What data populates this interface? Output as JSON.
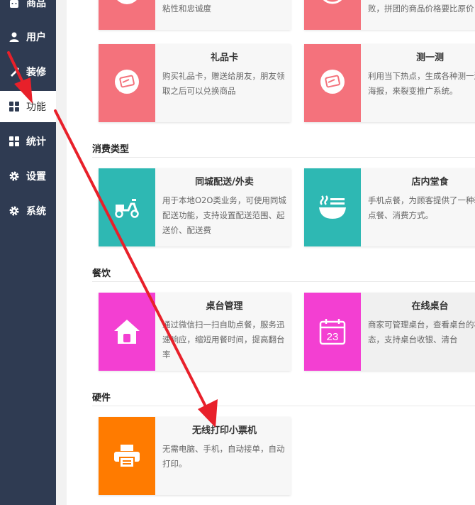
{
  "sidebar": {
    "items": [
      {
        "label": "商品",
        "icon": "bag-icon"
      },
      {
        "label": "用户",
        "icon": "user-icon"
      },
      {
        "label": "装修",
        "icon": "brush-icon"
      },
      {
        "label": "功能",
        "icon": "grid-icon",
        "active": true
      },
      {
        "label": "统计",
        "icon": "grid-icon"
      },
      {
        "label": "设置",
        "icon": "gear-icon"
      },
      {
        "label": "系统",
        "icon": "gear-icon"
      }
    ]
  },
  "top_cards": [
    {
      "desc": "值开消费赤额，生复购，提高客户粘性和忠诚度"
    },
    {
      "desc": "一起购买才能完成拼团，否则失败，拼团的商品价格要比原价"
    }
  ],
  "marketing_cards": [
    {
      "title": "礼品卡",
      "desc": "购买礼品卡，赠送给朋友，朋友领取之后可以兑换商品"
    },
    {
      "title": "测一测",
      "desc": "利用当下热点，生成各种测一测的海报，来裂变推广系统。"
    }
  ],
  "sections": [
    {
      "title": "消费类型",
      "cards": [
        {
          "title": "同城配送/外卖",
          "desc": "用于本地O2O类业务，可使用同城配送功能，支持设置配送范围、起送价、配送费"
        },
        {
          "title": "店内堂食",
          "desc": "手机点餐，为顾客提供了一种新的点餐、消费方式。"
        }
      ]
    },
    {
      "title": "餐饮",
      "cards": [
        {
          "title": "桌台管理",
          "desc": "通过微信扫一扫自助点餐，服务迅速响应，缩短用餐时间，提高翻台率"
        },
        {
          "title": "在线桌台",
          "desc": "商家可管理桌台，查看桌台的状态，支持桌台收银、清台",
          "icon_text": "23"
        }
      ]
    },
    {
      "title": "硬件",
      "cards": [
        {
          "title": "无线打印小票机",
          "desc": "无需电脑、手机，自动接单，自动打印。"
        }
      ]
    }
  ],
  "colors": {
    "sidebar": "#2f3b52",
    "pink": "#f4727c",
    "teal": "#2eb8b3",
    "magenta": "#f33fd2",
    "orange": "#ff7b00",
    "arrow": "#e8202a"
  }
}
